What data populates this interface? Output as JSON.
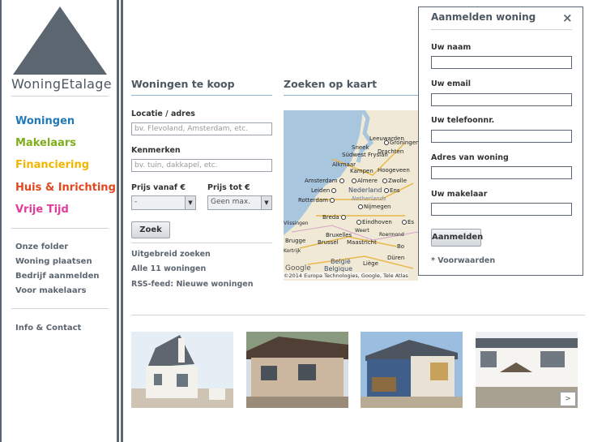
{
  "brand": {
    "logo_text": "WoningEtalage"
  },
  "nav": {
    "primary": [
      {
        "label": "Woningen",
        "color": "#1f7ab7"
      },
      {
        "label": "Makelaars",
        "color": "#7fae1b"
      },
      {
        "label": "Financiering",
        "color": "#f2b600"
      },
      {
        "label": "Huis & Inrichting",
        "color": "#e2481e"
      },
      {
        "label": "Vrije Tijd",
        "color": "#e33b9b"
      }
    ],
    "secondary": [
      "Onze folder",
      "Woning plaatsen",
      "Bedrijf aanmelden",
      "Voor makelaars"
    ],
    "info": "Info & Contact"
  },
  "search": {
    "heading": "Woningen te koop",
    "location_label": "Locatie / adres",
    "location_placeholder": "bv. Flevoland, Amsterdam, etc.",
    "features_label": "Kenmerken",
    "features_placeholder": "bv. tuin, dakkapel, etc.",
    "price_from_label": "Prijs vanaf €",
    "price_from_value": "-",
    "price_to_label": "Prijs tot €",
    "price_to_value": "Geen max.",
    "search_button": "Zoek",
    "links": [
      "Uitgebreid zoeken",
      "Alle 11 woningen",
      "RSS-feed: Nieuwe woningen"
    ]
  },
  "map": {
    "heading": "Zoeken op kaart",
    "attribution": "©2014 Europa Technologies, Google, Tele Atlas",
    "cities": [
      "Leeuwarden",
      "Groningen",
      "Sneek",
      "Drachten",
      "Súdwest Fryslân",
      "Alkmaar",
      "Kampen",
      "Hoogeveen",
      "Amsterdam",
      "Almere",
      "Zwolle",
      "Leiden",
      "Nederland",
      "Ens",
      "Rotterdam",
      "Netherlands",
      "Nijmegen",
      "Breda",
      "Eindhoven",
      "Es",
      "Vlissingen",
      "Brugge",
      "Bruxelles",
      "Brussel",
      "Weert",
      "Roermond",
      "Maastricht",
      "Kortrijk",
      "België",
      "Belgique",
      "Liège",
      "Düren",
      "Bo",
      "Google"
    ]
  },
  "modal": {
    "title": "Aanmelden woning",
    "close": "×",
    "fields": [
      "Uw naam",
      "Uw email",
      "Uw telefoonnr.",
      "Adres van woning",
      "Uw makelaar"
    ],
    "submit": "Aanmelden",
    "terms": "* Voorwaarden"
  },
  "carousel": {
    "next": ">"
  },
  "colors": {
    "brand_gray": "#5c6670",
    "accent_rule": "#8fb3c9",
    "map_water": "#a9c6df"
  }
}
